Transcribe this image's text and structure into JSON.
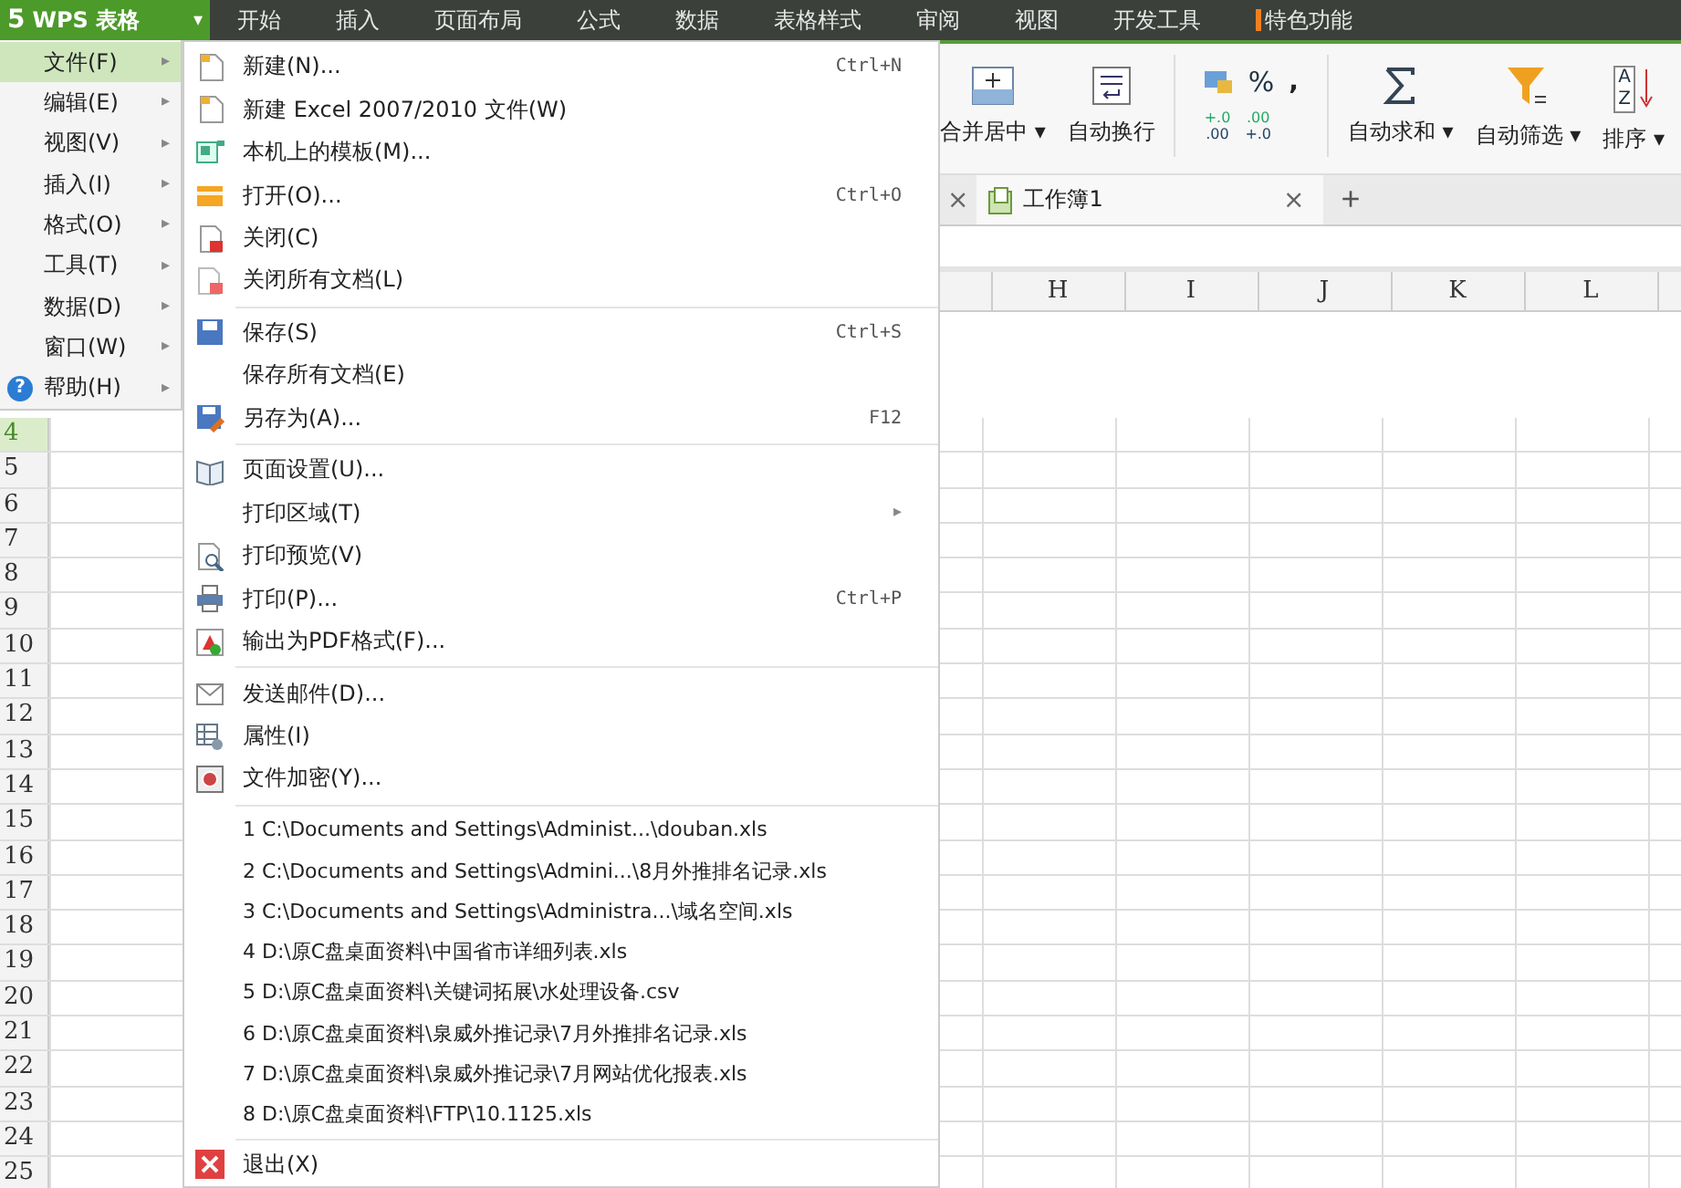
{
  "app_button": {
    "logo": "5",
    "label": "WPS 表格",
    "caret": "▾"
  },
  "ribbon_tabs": [
    {
      "label": "开始",
      "marked": false
    },
    {
      "label": "插入",
      "marked": false
    },
    {
      "label": "页面布局",
      "marked": false
    },
    {
      "label": "公式",
      "marked": false
    },
    {
      "label": "数据",
      "marked": false
    },
    {
      "label": "表格样式",
      "marked": false
    },
    {
      "label": "审阅",
      "marked": false
    },
    {
      "label": "视图",
      "marked": false
    },
    {
      "label": "开发工具",
      "marked": false
    },
    {
      "label": "特色功能",
      "marked": true
    }
  ],
  "ribbon": {
    "buttons": [
      {
        "kind": "merge",
        "label": "合并居中",
        "caret": "▾"
      },
      {
        "kind": "wrap",
        "label": "自动换行"
      },
      {
        "kind": "number",
        "label": "%",
        "extra": ",",
        "decimal_buttons": [
          {
            "top": "+.0",
            "bottom": ".00"
          },
          {
            "top": ".00",
            "bottom": "+.0"
          }
        ]
      },
      {
        "kind": "sum",
        "label": "自动求和",
        "caret": "▾"
      },
      {
        "kind": "filter",
        "label": "自动筛选",
        "caret": "▾"
      },
      {
        "kind": "sort",
        "label": "排序",
        "caret": "▾",
        "icon_letters": [
          "A",
          "Z"
        ]
      }
    ]
  },
  "doc_tabs": {
    "prev_close": "×",
    "tabs": [
      {
        "label": "工作簿1",
        "close": "×",
        "selected": true
      }
    ],
    "add": "+"
  },
  "sheet": {
    "columns": [
      "H",
      "I",
      "J",
      "K",
      "L"
    ],
    "rows": [
      {
        "label": "4",
        "selected": true
      },
      {
        "label": "5",
        "selected": false
      },
      {
        "label": "6",
        "selected": false
      },
      {
        "label": "7",
        "selected": false
      },
      {
        "label": "8",
        "selected": false
      },
      {
        "label": "9",
        "selected": false
      },
      {
        "label": "10",
        "selected": false
      },
      {
        "label": "11",
        "selected": false
      },
      {
        "label": "12",
        "selected": false
      },
      {
        "label": "13",
        "selected": false
      },
      {
        "label": "14",
        "selected": false
      },
      {
        "label": "15",
        "selected": false
      },
      {
        "label": "16",
        "selected": false
      },
      {
        "label": "17",
        "selected": false
      },
      {
        "label": "18",
        "selected": false
      },
      {
        "label": "19",
        "selected": false
      },
      {
        "label": "20",
        "selected": false
      },
      {
        "label": "21",
        "selected": false
      },
      {
        "label": "22",
        "selected": false
      },
      {
        "label": "23",
        "selected": false
      },
      {
        "label": "24",
        "selected": false
      },
      {
        "label": "25",
        "selected": false
      }
    ]
  },
  "main_menu": {
    "items": [
      {
        "kind": "item",
        "label": "文件(F)",
        "selected": true
      },
      {
        "kind": "item",
        "label": "编辑(E)",
        "selected": false
      },
      {
        "kind": "item",
        "label": "视图(V)",
        "selected": false
      },
      {
        "kind": "item",
        "label": "插入(I)",
        "selected": false
      },
      {
        "kind": "item",
        "label": "格式(O)",
        "selected": false
      },
      {
        "kind": "item",
        "label": "工具(T)",
        "selected": false
      },
      {
        "kind": "item",
        "label": "数据(D)",
        "selected": false
      },
      {
        "kind": "item",
        "label": "窗口(W)",
        "selected": false
      },
      {
        "kind": "help",
        "label": "帮助(H)",
        "selected": false,
        "badge": "?"
      }
    ],
    "arrow": "▸"
  },
  "file_menu": {
    "items": [
      {
        "kind": "new",
        "label": "新建(N)...",
        "shortcut": "Ctrl+N"
      },
      {
        "kind": "new",
        "label": "新建 Excel 2007/2010 文件(W)"
      },
      {
        "kind": "template",
        "label": "本机上的模板(M)..."
      },
      {
        "kind": "open",
        "label": "打开(O)...",
        "shortcut": "Ctrl+O"
      },
      {
        "kind": "close",
        "label": "关闭(C)"
      },
      {
        "kind": "closeall",
        "label": "关闭所有文档(L)"
      },
      {
        "kind": "separator"
      },
      {
        "kind": "save",
        "label": "保存(S)",
        "shortcut": "Ctrl+S"
      },
      {
        "kind": "plain",
        "label": "保存所有文档(E)"
      },
      {
        "kind": "saveas",
        "label": "另存为(A)...",
        "shortcut": "F12"
      },
      {
        "kind": "separator"
      },
      {
        "kind": "pagesetup",
        "label": "页面设置(U)..."
      },
      {
        "kind": "plain",
        "label": "打印区域(T)",
        "arrow": "▸"
      },
      {
        "kind": "preview",
        "label": "打印预览(V)"
      },
      {
        "kind": "print",
        "label": "打印(P)...",
        "shortcut": "Ctrl+P"
      },
      {
        "kind": "pdf",
        "label": "输出为PDF格式(F)..."
      },
      {
        "kind": "separator"
      },
      {
        "kind": "mail",
        "label": "发送邮件(D)..."
      },
      {
        "kind": "props",
        "label": "属性(I)"
      },
      {
        "kind": "encrypt",
        "label": "文件加密(Y)..."
      },
      {
        "kind": "separator"
      },
      {
        "kind": "recent",
        "label": "1 C:\\Documents and Settings\\Administ...\\douban.xls"
      },
      {
        "kind": "recent",
        "label": "2 C:\\Documents and Settings\\Admini...\\8月外推排名记录.xls"
      },
      {
        "kind": "recent",
        "label": "3 C:\\Documents and Settings\\Administra...\\域名空间.xls"
      },
      {
        "kind": "recent",
        "label": "4 D:\\原C盘桌面资料\\中国省市详细列表.xls"
      },
      {
        "kind": "recent",
        "label": "5 D:\\原C盘桌面资料\\关键词拓展\\水处理设备.csv"
      },
      {
        "kind": "recent",
        "label": "6 D:\\原C盘桌面资料\\泉威外推记录\\7月外推排名记录.xls"
      },
      {
        "kind": "recent",
        "label": "7 D:\\原C盘桌面资料\\泉威外推记录\\7月网站优化报表.xls"
      },
      {
        "kind": "recent",
        "label": "8 D:\\原C盘桌面资料\\FTP\\10.1125.xls"
      },
      {
        "kind": "separator"
      },
      {
        "kind": "exit",
        "label": "退出(X)"
      }
    ]
  }
}
